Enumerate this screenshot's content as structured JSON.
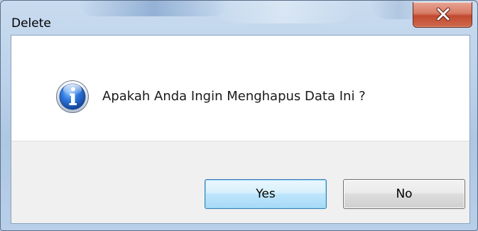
{
  "window": {
    "title": "Delete"
  },
  "titlebar": {
    "close_icon": "close-icon"
  },
  "dialog": {
    "icon": "info-icon",
    "message": "Apakah Anda Ingin Menghapus Data Ini ?"
  },
  "buttons": {
    "yes_label": "Yes",
    "no_label": "No"
  },
  "colors": {
    "close_button": "#c14a30",
    "default_button_border": "#3c7fb1",
    "info_icon_blue": "#1f5fbf",
    "button_area_bg": "#f0f0f0"
  }
}
